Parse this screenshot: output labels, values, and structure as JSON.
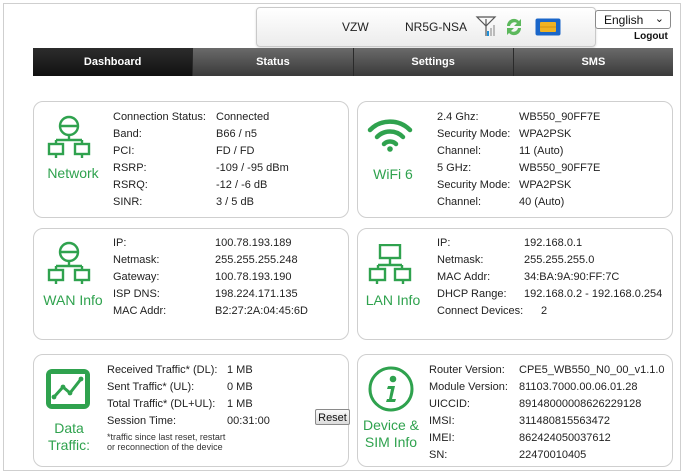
{
  "status_bar": {
    "carrier": "VZW",
    "technology": "NR5G-NSA",
    "signal_icon": "signal-bars-icon",
    "sync_icon": "sync-arrows-icon",
    "sim_icon": "sim-card-icon"
  },
  "header": {
    "language_selected": "English",
    "logout_label": "Logout"
  },
  "nav": {
    "tabs": [
      {
        "label": "Dashboard",
        "active": true
      },
      {
        "label": "Status",
        "active": false
      },
      {
        "label": "Settings",
        "active": false
      },
      {
        "label": "SMS",
        "active": false
      }
    ]
  },
  "network": {
    "title": "Network",
    "rows": [
      {
        "k": "Connection Status:",
        "v": "Connected"
      },
      {
        "k": "Band:",
        "v": "B66 / n5"
      },
      {
        "k": "PCI:",
        "v": "FD / FD"
      },
      {
        "k": "RSRP:",
        "v": "-109 / -95 dBm"
      },
      {
        "k": "RSRQ:",
        "v": "-12 / -6 dB"
      },
      {
        "k": "SINR:",
        "v": "3 / 5 dB"
      }
    ]
  },
  "wifi": {
    "title": "WiFi 6",
    "rows": [
      {
        "k": "2.4 Ghz:",
        "v": "WB550_90FF7E"
      },
      {
        "k": "Security Mode:",
        "v": "WPA2PSK"
      },
      {
        "k": "Channel:",
        "v": "11 (Auto)"
      },
      {
        "k": "5 GHz:",
        "v": "WB550_90FF7E"
      },
      {
        "k": "Security Mode:",
        "v": "WPA2PSK"
      },
      {
        "k": "Channel:",
        "v": "40 (Auto)"
      }
    ]
  },
  "wan": {
    "title": "WAN Info",
    "rows": [
      {
        "k": "IP:",
        "v": "100.78.193.189"
      },
      {
        "k": "Netmask:",
        "v": "255.255.255.248"
      },
      {
        "k": "Gateway:",
        "v": "100.78.193.190"
      },
      {
        "k": "ISP DNS:",
        "v": "198.224.171.135"
      },
      {
        "k": "MAC Addr:",
        "v": "B2:27:2A:04:45:6D"
      }
    ]
  },
  "lan": {
    "title": "LAN Info",
    "rows": [
      {
        "k": "IP:",
        "v": "192.168.0.1"
      },
      {
        "k": "Netmask:",
        "v": "255.255.255.0"
      },
      {
        "k": "MAC Addr:",
        "v": "34:BA:9A:90:FF:7C"
      },
      {
        "k": "DHCP Range:",
        "v": "192.168.0.2 - 192.168.0.254"
      },
      {
        "k": "Connect Devices:",
        "v": "2"
      }
    ]
  },
  "traffic": {
    "title_line1": "Data",
    "title_line2": "Traffic:",
    "rows": [
      {
        "k": "Received Traffic* (DL):",
        "v": "1 MB"
      },
      {
        "k": "Sent Traffic* (UL):",
        "v": "0 MB"
      },
      {
        "k": "Total Traffic* (DL+UL):",
        "v": "1 MB"
      },
      {
        "k": "Session Time:",
        "v": "00:31:00"
      }
    ],
    "reset_label": "Reset",
    "note_line1": "*traffic since last reset, restart",
    "note_line2": "or reconnection of the device"
  },
  "device": {
    "title_line1": "Device &",
    "title_line2": "SIM Info",
    "rows": [
      {
        "k": "Router Version:",
        "v": "CPE5_WB550_N0_00_v1.1.0"
      },
      {
        "k": "Module Version:",
        "v": "81103.7000.00.06.01.28"
      },
      {
        "k": "UICCID:",
        "v": "89148000008626229128"
      },
      {
        "k": "IMSI:",
        "v": "311480815563472"
      },
      {
        "k": "IMEI:",
        "v": "862424050037612"
      },
      {
        "k": "SN:",
        "v": "22470010405"
      }
    ]
  },
  "colors": {
    "accent_green": "#2fa24e",
    "nav_dark": "#3a3a3a",
    "sync_green": "#5cb85c",
    "sim_blue": "#1a66c9",
    "sim_gold": "#f0b323"
  }
}
